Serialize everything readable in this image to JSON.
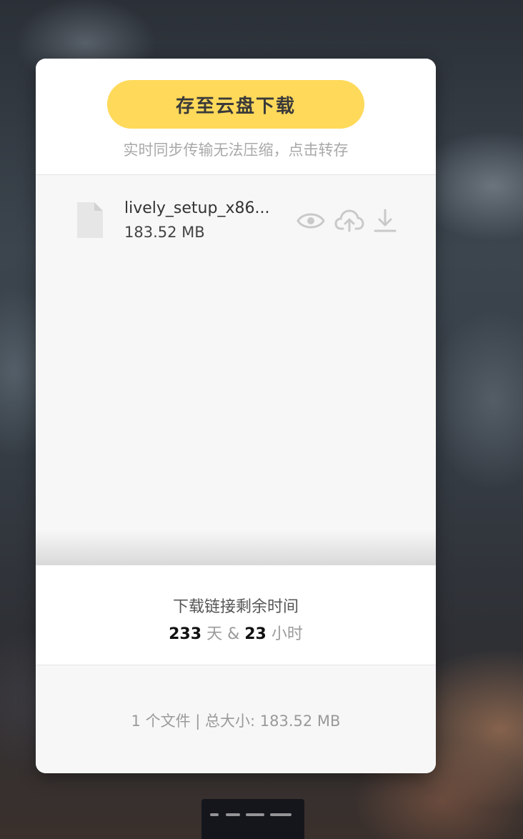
{
  "dialog": {
    "save_button_label": "存至云盘下载",
    "hint_text": "实时同步传输无法压缩，点击转存"
  },
  "files": [
    {
      "name": "lively_setup_x86...",
      "size": "183.52 MB",
      "icon": "file-icon",
      "actions": [
        "eye-icon",
        "cloud-upload-icon",
        "download-icon"
      ]
    }
  ],
  "expiry": {
    "title": "下载链接剩余时间",
    "days": "233",
    "days_unit": "天",
    "separator": "&",
    "hours": "23",
    "hours_unit": "小时"
  },
  "summary": {
    "text": "1 个文件 | 总大小: 183.52 MB"
  },
  "colors": {
    "accent": "#ffd95a",
    "card_bg": "#ffffff",
    "list_bg": "#f7f7f7",
    "muted_text": "#a9a9a9"
  }
}
